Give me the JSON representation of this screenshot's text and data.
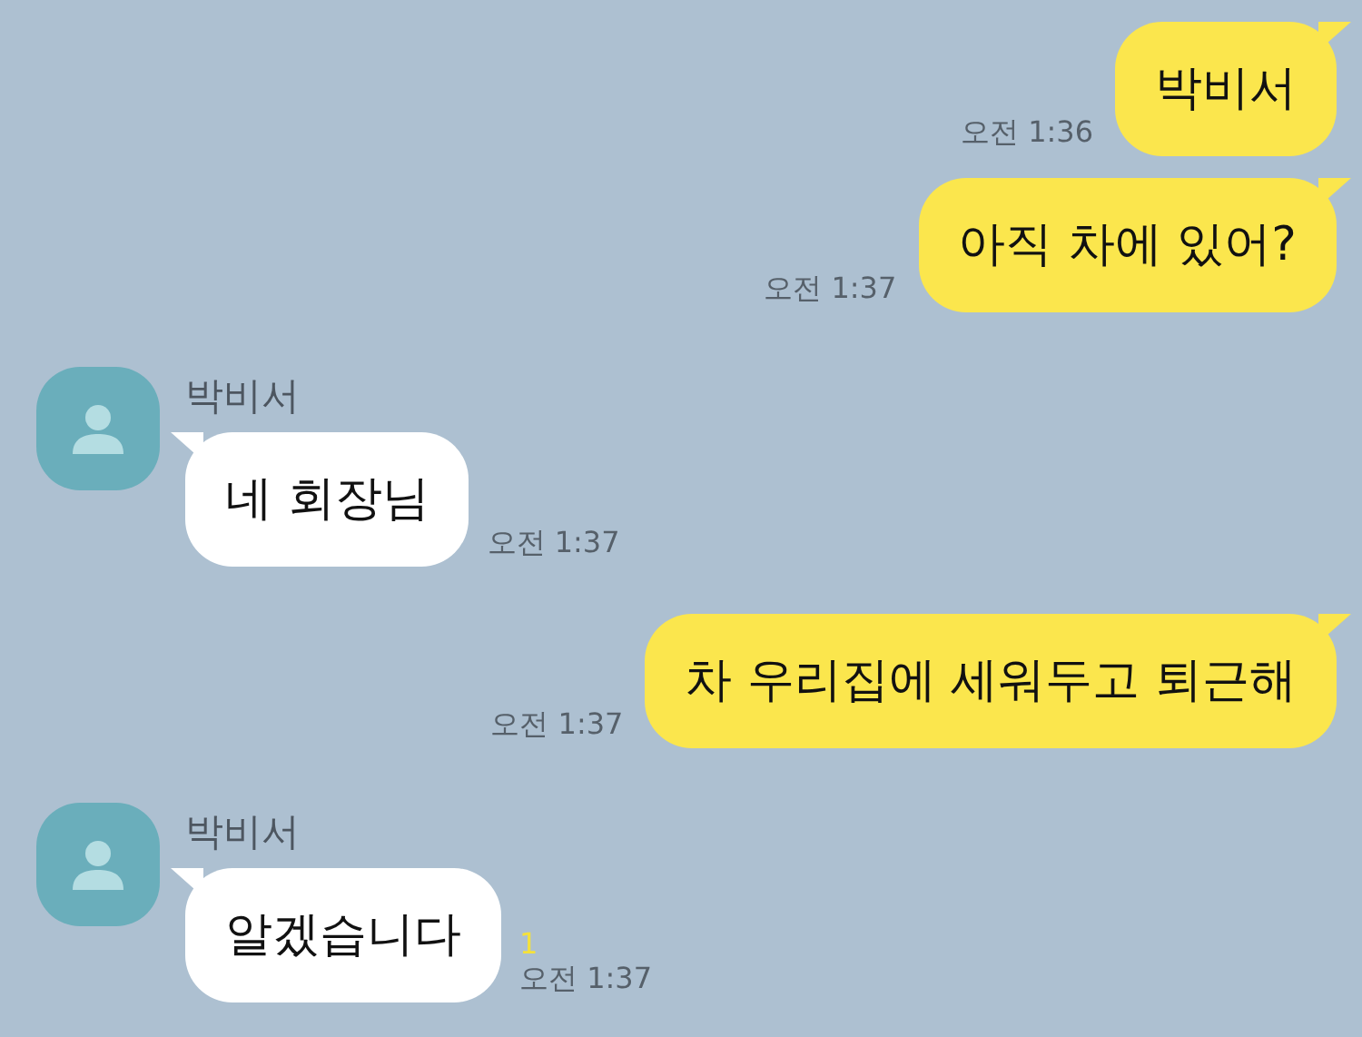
{
  "messages": [
    {
      "kind": "sent",
      "text": "박비서",
      "time": "오전 1:36"
    },
    {
      "kind": "sent",
      "text": "아직 차에 있어?",
      "time": "오전 1:37"
    },
    {
      "kind": "received",
      "sender": "박비서",
      "text": "네 회장님",
      "time": "오전 1:37"
    },
    {
      "kind": "sent",
      "text": "차 우리집에 세워두고 퇴근해",
      "time": "오전 1:37"
    },
    {
      "kind": "received",
      "sender": "박비서",
      "text": "알겠습니다",
      "time": "오전 1:37",
      "unread": "1"
    }
  ]
}
